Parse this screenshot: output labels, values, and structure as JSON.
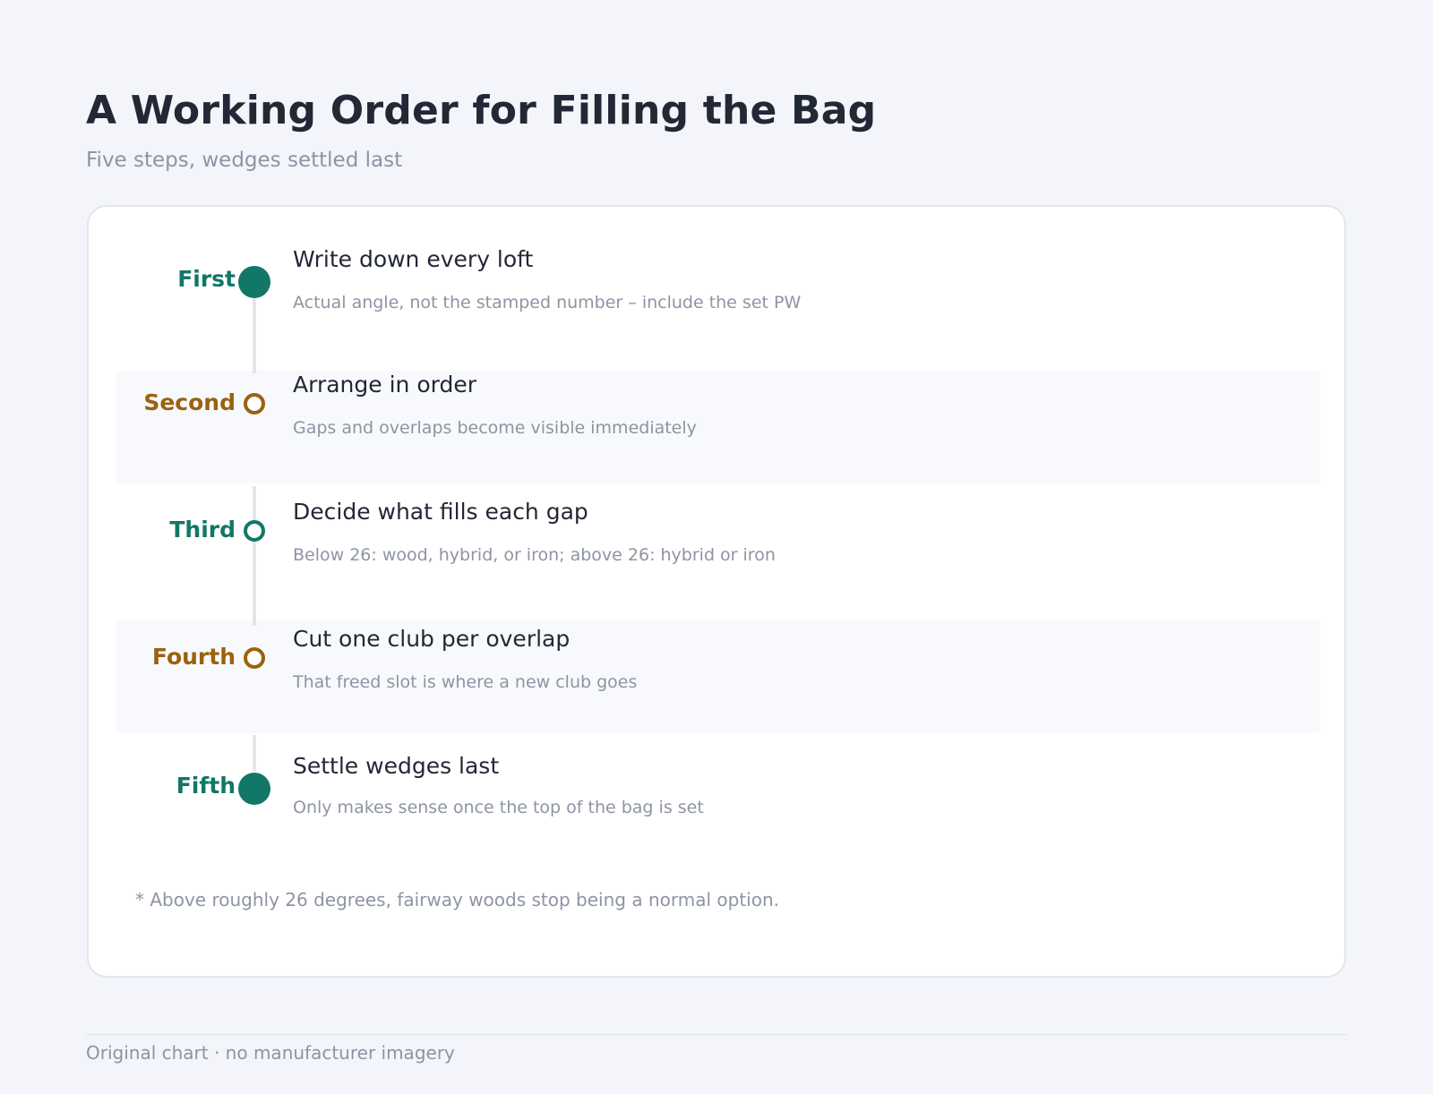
{
  "header": {
    "title": "A Working Order for Filling the Bag",
    "subtitle": "Five steps, wedges settled last"
  },
  "steps": [
    {
      "label": "First",
      "title": "Write down every loft",
      "description": "Actual angle, not the stamped number – include the set PW",
      "marker": "filled-dot",
      "color": "#127766"
    },
    {
      "label": "Second",
      "title": "Arrange in order",
      "description": "Gaps and overlaps become visible immediately",
      "marker": "ring",
      "color": "#9a6210"
    },
    {
      "label": "Third",
      "title": "Decide what fills each gap",
      "description": "Below 26: wood, hybrid, or iron; above 26: hybrid or iron",
      "marker": "ring",
      "color": "#127766"
    },
    {
      "label": "Fourth",
      "title": "Cut one club per overlap",
      "description": "That freed slot is where a new club goes",
      "marker": "ring",
      "color": "#9a6210"
    },
    {
      "label": "Fifth",
      "title": "Settle wedges last",
      "description": "Only makes sense once the top of the bag is set",
      "marker": "filled-dot",
      "color": "#127766"
    }
  ],
  "footnote": "* Above roughly 26 degrees, fairway woods stop being a normal option.",
  "credit": "Original chart · no manufacturer imagery"
}
